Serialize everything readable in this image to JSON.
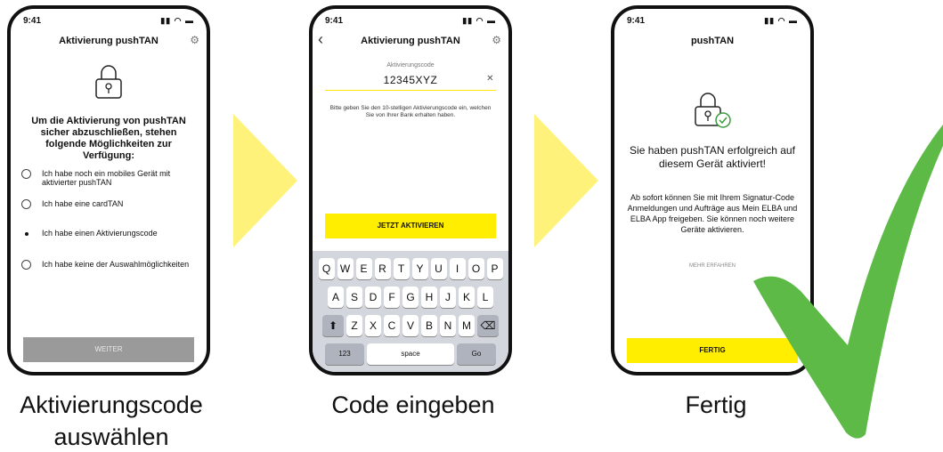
{
  "status": {
    "time": "9:41",
    "icons": "signal-wifi-battery"
  },
  "screen1": {
    "title": "Aktivierung pushTAN",
    "heading": "Um die Aktivierung von pushTAN sicher abzuschließen, stehen folgende Möglichkeiten zur Verfügung:",
    "options": [
      "Ich habe noch ein mobiles Gerät mit aktivierter pushTAN",
      "Ich habe eine cardTAN",
      "Ich habe einen Aktivierungscode",
      "Ich habe keine der Auswahlmöglichkeiten"
    ],
    "button": "WEITER"
  },
  "screen2": {
    "title": "Aktivierung pushTAN",
    "field_label": "Aktivierungscode",
    "field_value": "12345XYZ",
    "hint": "Bitte geben Sie den 10-stelligen Aktivierungscode ein, welchen Sie von Ihrer Bank erhalten haben.",
    "button": "JETZT AKTIVIEREN",
    "keyboard": {
      "row1": [
        "Q",
        "W",
        "E",
        "R",
        "T",
        "Y",
        "U",
        "I",
        "O",
        "P"
      ],
      "row2": [
        "A",
        "S",
        "D",
        "F",
        "G",
        "H",
        "J",
        "K",
        "L"
      ],
      "row3": [
        "Z",
        "X",
        "C",
        "V",
        "B",
        "N",
        "M"
      ],
      "num_key": "123",
      "space_key": "space",
      "go_key": "Go"
    }
  },
  "screen3": {
    "title": "pushTAN",
    "success": "Sie haben pushTAN erfolgreich auf diesem Gerät aktiviert!",
    "info": "Ab sofort können Sie mit Ihrem Signatur-Code Anmeldungen und Aufträge aus Mein ELBA und ELBA App freigeben. Sie können noch weitere Geräte aktivieren.",
    "more_link": "MEHR ERFAHREN",
    "button": "FERTIG"
  },
  "captions": {
    "step1": "Aktivierungscode auswählen",
    "step2": "Code eingeben",
    "step3": "Fertig"
  },
  "colors": {
    "accent_yellow": "#ffee00",
    "arrow_yellow": "#fff27a",
    "check_green": "#5dba47"
  }
}
